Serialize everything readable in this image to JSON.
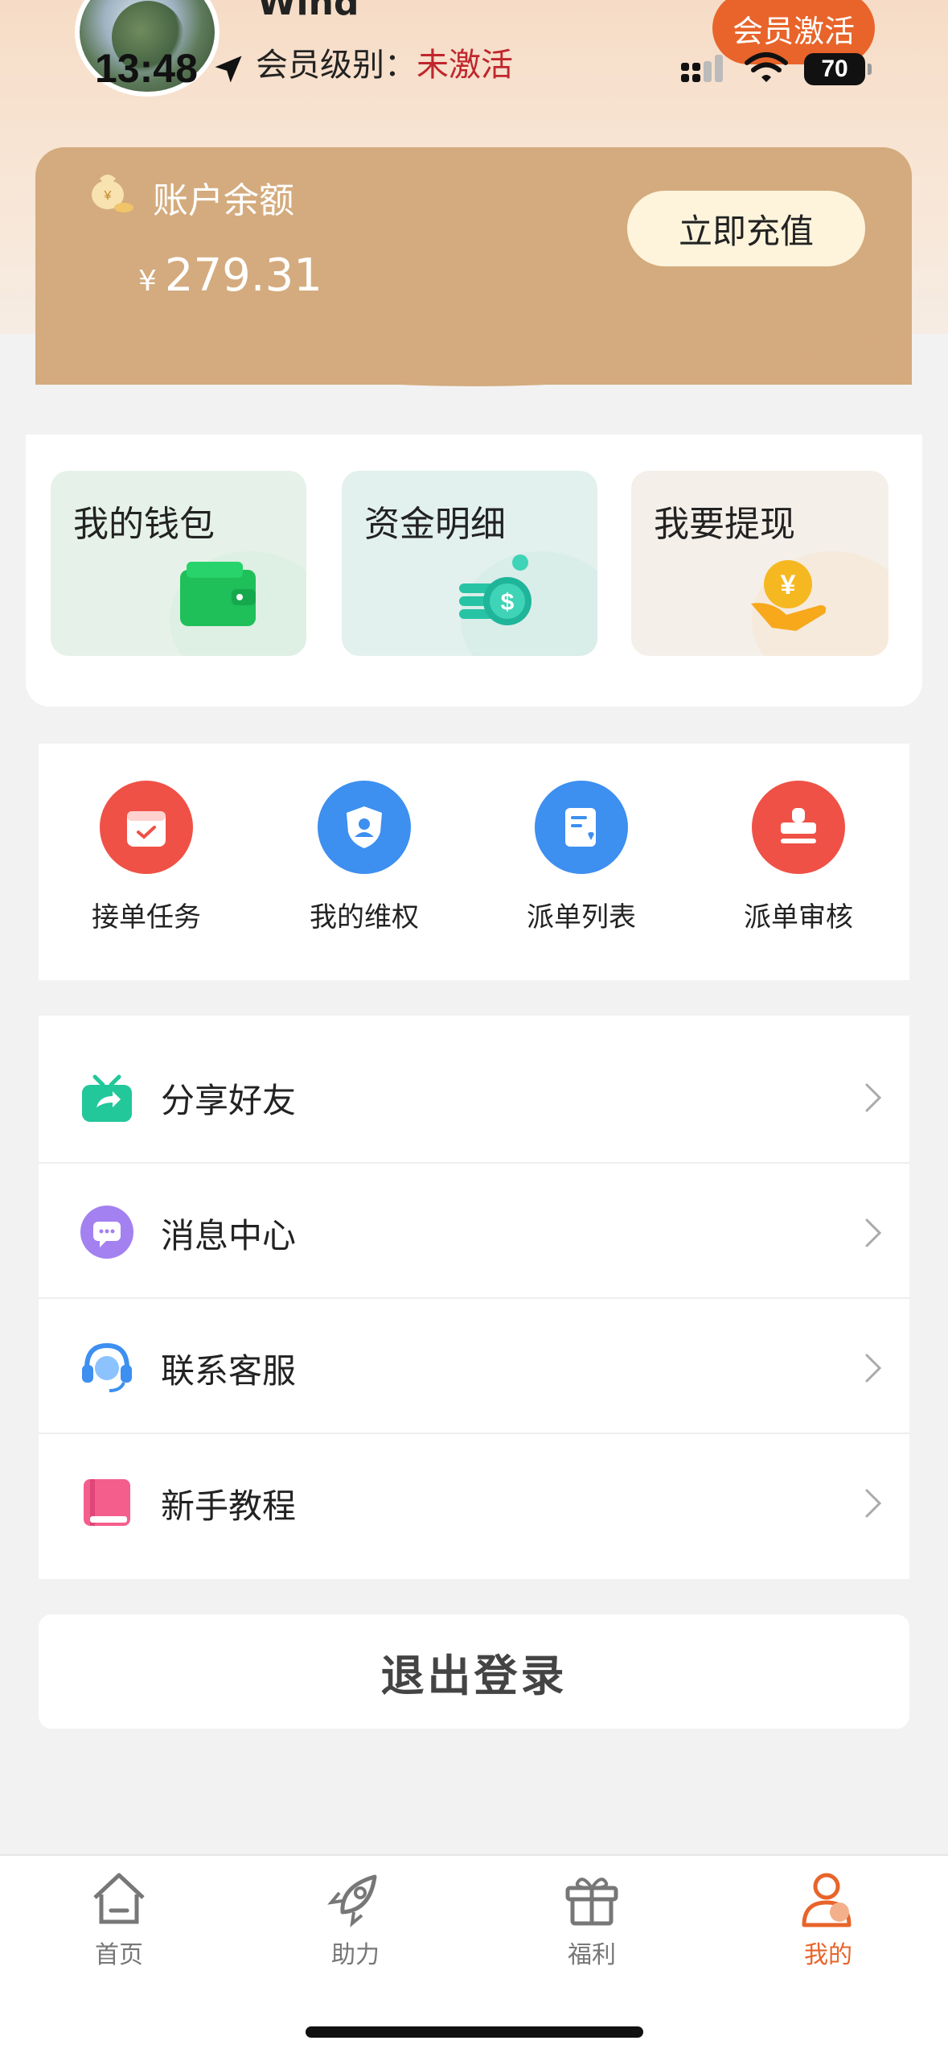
{
  "status_bar": {
    "time": "13:48",
    "battery": "70"
  },
  "profile": {
    "username": "Wind",
    "member_level_label": "会员级别：",
    "member_level_value": "未激活",
    "activate_button": "会员激活"
  },
  "balance": {
    "title": "账户余额",
    "currency": "¥",
    "amount": "279.31",
    "recharge_button": "立即充值"
  },
  "wallet_tiles": [
    {
      "label": "我的钱包",
      "icon": "wallet-icon"
    },
    {
      "label": "资金明细",
      "icon": "coins-icon"
    },
    {
      "label": "我要提现",
      "icon": "yen-hand-icon"
    }
  ],
  "tasks": [
    {
      "label": "接单任务",
      "icon": "task-calendar-icon",
      "color": "#ef5146"
    },
    {
      "label": "我的维权",
      "icon": "shield-user-icon",
      "color": "#3d8ff0"
    },
    {
      "label": "派单列表",
      "icon": "dispatch-list-icon",
      "color": "#3d8ff0"
    },
    {
      "label": "派单审核",
      "icon": "stamp-icon",
      "color": "#ef5146"
    }
  ],
  "menu": [
    {
      "label": "分享好友",
      "icon": "share-gift-icon"
    },
    {
      "label": "消息中心",
      "icon": "message-icon"
    },
    {
      "label": "联系客服",
      "icon": "headset-icon"
    },
    {
      "label": "新手教程",
      "icon": "book-icon"
    }
  ],
  "logout_button": "退出登录",
  "tabs": [
    {
      "label": "首页",
      "icon": "home-icon",
      "active": false
    },
    {
      "label": "助力",
      "icon": "rocket-icon",
      "active": false
    },
    {
      "label": "福利",
      "icon": "gift-icon",
      "active": false
    },
    {
      "label": "我的",
      "icon": "user-icon",
      "active": true
    }
  ],
  "colors": {
    "accent": "#e8642a",
    "balance_card": "#d4ab7e",
    "inactive_status": "#c0262d"
  }
}
